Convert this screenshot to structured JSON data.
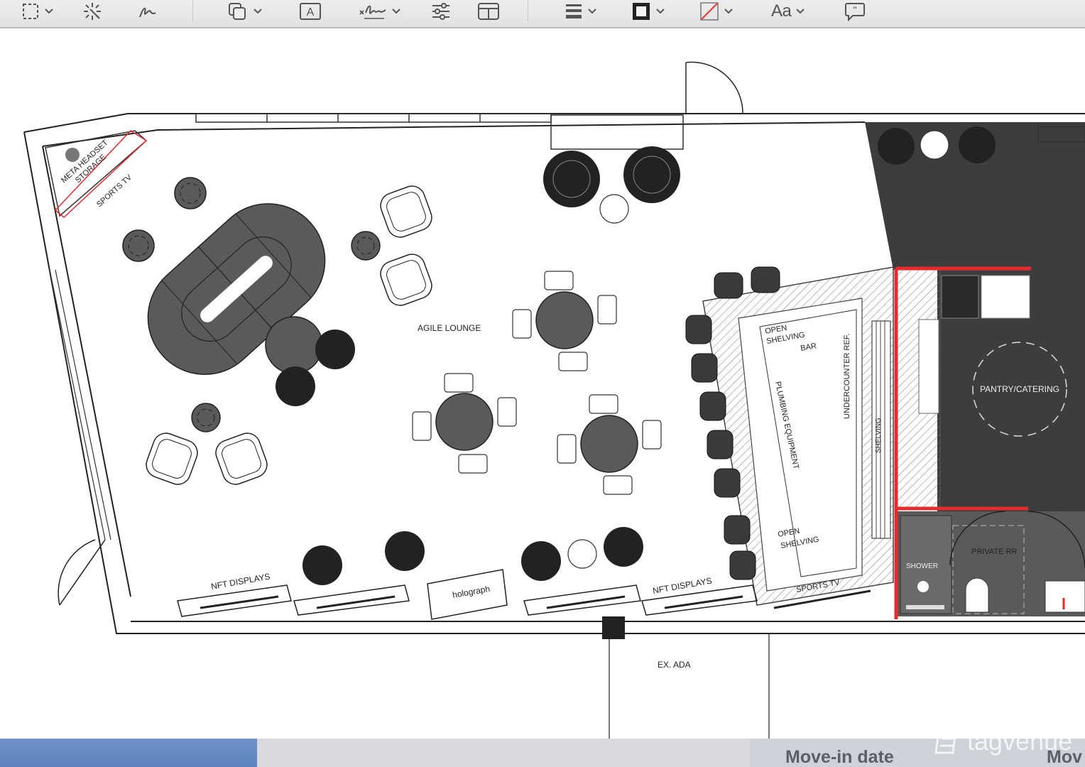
{
  "toolbar": {
    "tools": [
      {
        "icon": "rectangular-selection-icon"
      },
      {
        "icon": "instant-alpha-icon"
      },
      {
        "icon": "sketch-icon"
      },
      {
        "icon": "shapes-icon"
      },
      {
        "icon": "text-box-icon"
      },
      {
        "icon": "signature-icon"
      },
      {
        "icon": "adjust-color-icon"
      },
      {
        "icon": "adjust-size-icon"
      },
      {
        "icon": "shape-style-icon"
      },
      {
        "icon": "border-color-icon"
      },
      {
        "icon": "fill-color-icon"
      },
      {
        "icon": "text-style-icon"
      },
      {
        "icon": "description-icon"
      }
    ],
    "text_style_label": "Aa"
  },
  "floorplan": {
    "labels": {
      "meta_headset_storage_1": "META HEADSET",
      "meta_headset_storage_2": "STORAGE",
      "sports_tv_left": "SPORTS TV",
      "agile_lounge": "AGILE LOUNGE",
      "open_shelving_top_1": "OPEN",
      "open_shelving_top_2": "SHELVING",
      "bar": "BAR",
      "plumbing_equipment": "PLUMBING EQUIPMENT",
      "undercounter_ref": "UNDERCOUNTER REF.",
      "shelving": "SHELVING",
      "pantry_catering": "PANTRY/CATERING",
      "open_shelving_bottom_1": "OPEN",
      "open_shelving_bottom_2": "SHELVING",
      "sports_tv_bottom": "SPORTS TV",
      "private_rr": "PRIVATE RR",
      "shower": "SHOWER",
      "nft_displays_left": "NFT DISPLAYS",
      "nft_displays_right": "NFT DISPLAYS",
      "holograph": "holograph",
      "ex_ada": "EX. ADA"
    }
  },
  "bottom_bar": {
    "move_in_label": "Move-in date",
    "move_in_label_cut": "Mov"
  },
  "watermark": {
    "text": "tagvenue"
  },
  "colors": {
    "wall_red": "#e52b2b",
    "furniture_dark": "#5a5a5a",
    "dark_zone": "#3c3c3c"
  }
}
